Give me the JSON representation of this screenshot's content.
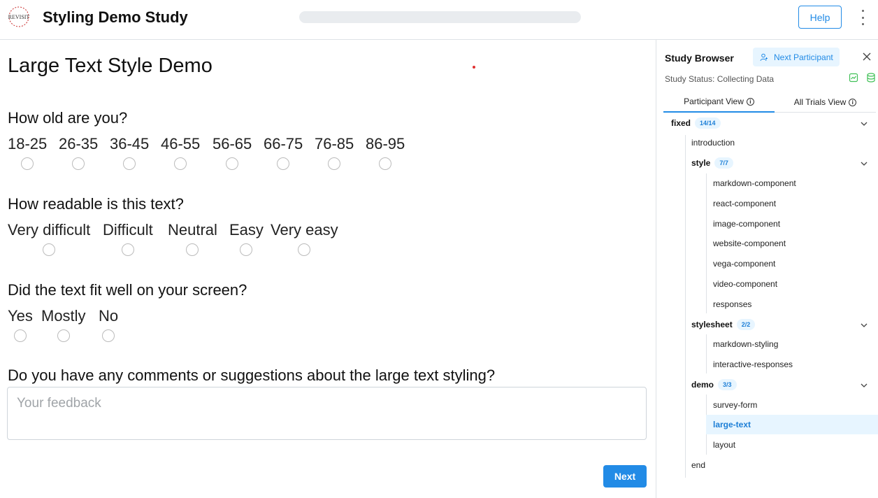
{
  "header": {
    "logo_text": "REVISIT",
    "app_title": "Styling Demo Study",
    "progress": 0.0,
    "help_label": "Help"
  },
  "main": {
    "page_title": "Large Text Style Demo",
    "q1": {
      "text": "How old are you?",
      "options": [
        "18-25",
        "26-35",
        "36-45",
        "46-55",
        "56-65",
        "66-75",
        "76-85",
        "86-95"
      ]
    },
    "q2": {
      "text": "How readable is this text?",
      "options": [
        "Very difficult",
        "Difficult",
        "Neutral",
        "Easy",
        "Very easy"
      ]
    },
    "q3": {
      "text": "Did the text fit well on your screen?",
      "options": [
        "Yes",
        "Mostly",
        "No"
      ]
    },
    "q4": {
      "text": "Do you have any comments or suggestions about the large text styling?",
      "placeholder": "Your feedback"
    },
    "next_label": "Next"
  },
  "sidebar": {
    "title": "Study Browser",
    "next_participant_label": "Next Participant",
    "status": "Study Status: Collecting Data",
    "tabs": [
      "Participant View",
      "All Trials View"
    ],
    "tree": {
      "fixed": {
        "label": "fixed",
        "badge": "14/14"
      },
      "introduction": "introduction",
      "style": {
        "label": "style",
        "badge": "7/7"
      },
      "style_items": [
        "markdown-component",
        "react-component",
        "image-component",
        "website-component",
        "vega-component",
        "video-component",
        "responses"
      ],
      "stylesheet": {
        "label": "stylesheet",
        "badge": "2/2"
      },
      "stylesheet_items": [
        "markdown-styling",
        "interactive-responses"
      ],
      "demo": {
        "label": "demo",
        "badge": "3/3"
      },
      "demo_items": [
        "survey-form",
        "large-text",
        "layout"
      ],
      "end": "end"
    }
  }
}
